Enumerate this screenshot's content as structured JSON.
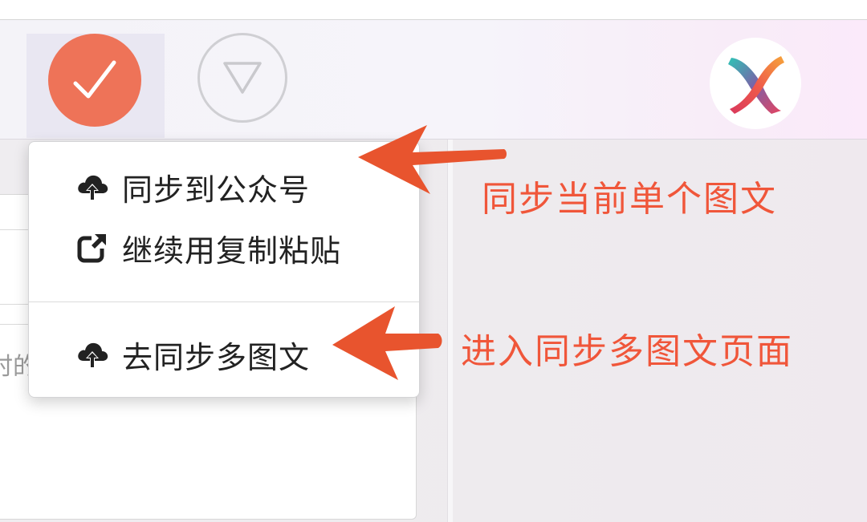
{
  "menu": {
    "items": [
      {
        "label": "同步到公众号",
        "icon": "cloud-upload-icon"
      },
      {
        "label": "继续用复制粘贴",
        "icon": "external-link-icon"
      },
      {
        "label": "去同步多图文",
        "icon": "cloud-upload-icon"
      }
    ]
  },
  "annotations": {
    "single": "同步当前单个图文",
    "multi": "进入同步多图文页面"
  },
  "editor": {
    "partial_text": "时的"
  },
  "colors": {
    "accent": "#ee7358",
    "annotation": "#f0563a",
    "arrow": "#e8542e"
  }
}
